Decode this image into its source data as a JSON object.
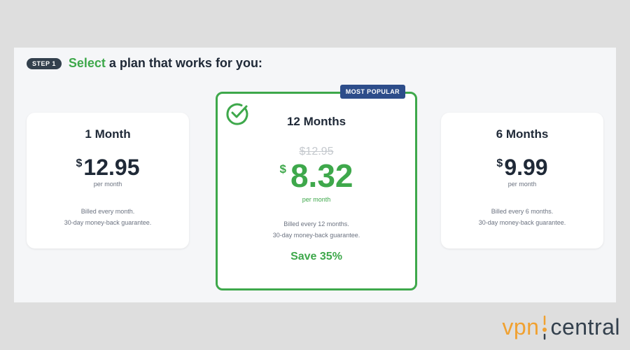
{
  "step": {
    "pill": "STEP 1",
    "heading_accent": "Select",
    "heading_rest": " a plan that works for you:"
  },
  "plans": [
    {
      "name": "1 Month",
      "currency": "$",
      "price": "12.95",
      "per": "per month",
      "billing_line1": "Billed every month.",
      "billing_line2": "30-day money-back guarantee."
    },
    {
      "name": "12 Months",
      "badge": "MOST POPULAR",
      "old_price": "$12.95",
      "currency": "$",
      "price": "8.32",
      "per": "per month",
      "billing_line1": "Billed every 12 months.",
      "billing_line2": "30-day money-back guarantee.",
      "save": "Save 35%",
      "selected": true
    },
    {
      "name": "6 Months",
      "currency": "$",
      "price": "9.99",
      "per": "per month",
      "billing_line1": "Billed every 6 months.",
      "billing_line2": "30-day money-back guarantee."
    }
  ],
  "watermark": {
    "left": "vpn",
    "right": "central"
  },
  "colors": {
    "accent_green": "#3ea84b",
    "badge_blue": "#2d4d8a",
    "pill_dark": "#33404d",
    "watermark_orange": "#f0a131"
  },
  "icons": {
    "selected": "check-circle-icon"
  }
}
